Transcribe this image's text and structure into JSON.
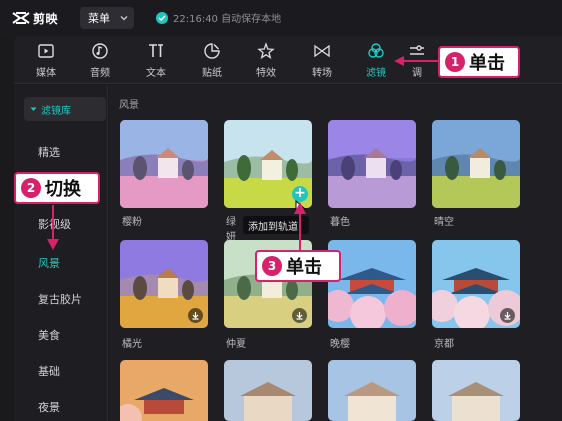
{
  "app": {
    "logo_text": "剪映",
    "menu_label": "菜单",
    "autosave_text": "22:16:40 自动保存本地"
  },
  "toolbar": {
    "items": [
      {
        "label": "媒体",
        "icon": "media-icon"
      },
      {
        "label": "音频",
        "icon": "audio-icon"
      },
      {
        "label": "文本",
        "icon": "text-icon"
      },
      {
        "label": "贴纸",
        "icon": "sticker-icon"
      },
      {
        "label": "特效",
        "icon": "effects-icon"
      },
      {
        "label": "转场",
        "icon": "transition-icon"
      },
      {
        "label": "滤镜",
        "icon": "filter-icon",
        "active": true
      },
      {
        "label": "调",
        "icon": "adjust-icon"
      }
    ]
  },
  "sidebar": {
    "header": "滤镜库",
    "items": [
      "精选",
      "影视级",
      "风景",
      "复古胶片",
      "美食",
      "基础",
      "夜景"
    ],
    "active_index": 2
  },
  "content": {
    "section_title": "风景",
    "filters": [
      {
        "label": "樱粉"
      },
      {
        "label": "绿妍"
      },
      {
        "label": "暮色"
      },
      {
        "label": "晴空"
      },
      {
        "label": "橘光"
      },
      {
        "label": "仲夏"
      },
      {
        "label": "晚樱"
      },
      {
        "label": "京都"
      }
    ],
    "tooltip": "添加到轨道"
  },
  "callouts": [
    {
      "num": "1",
      "text": "单击"
    },
    {
      "num": "2",
      "text": "切换"
    },
    {
      "num": "3",
      "text": "单击"
    }
  ],
  "colors": {
    "accent": "#22c8c2",
    "callout": "#d6226b"
  }
}
